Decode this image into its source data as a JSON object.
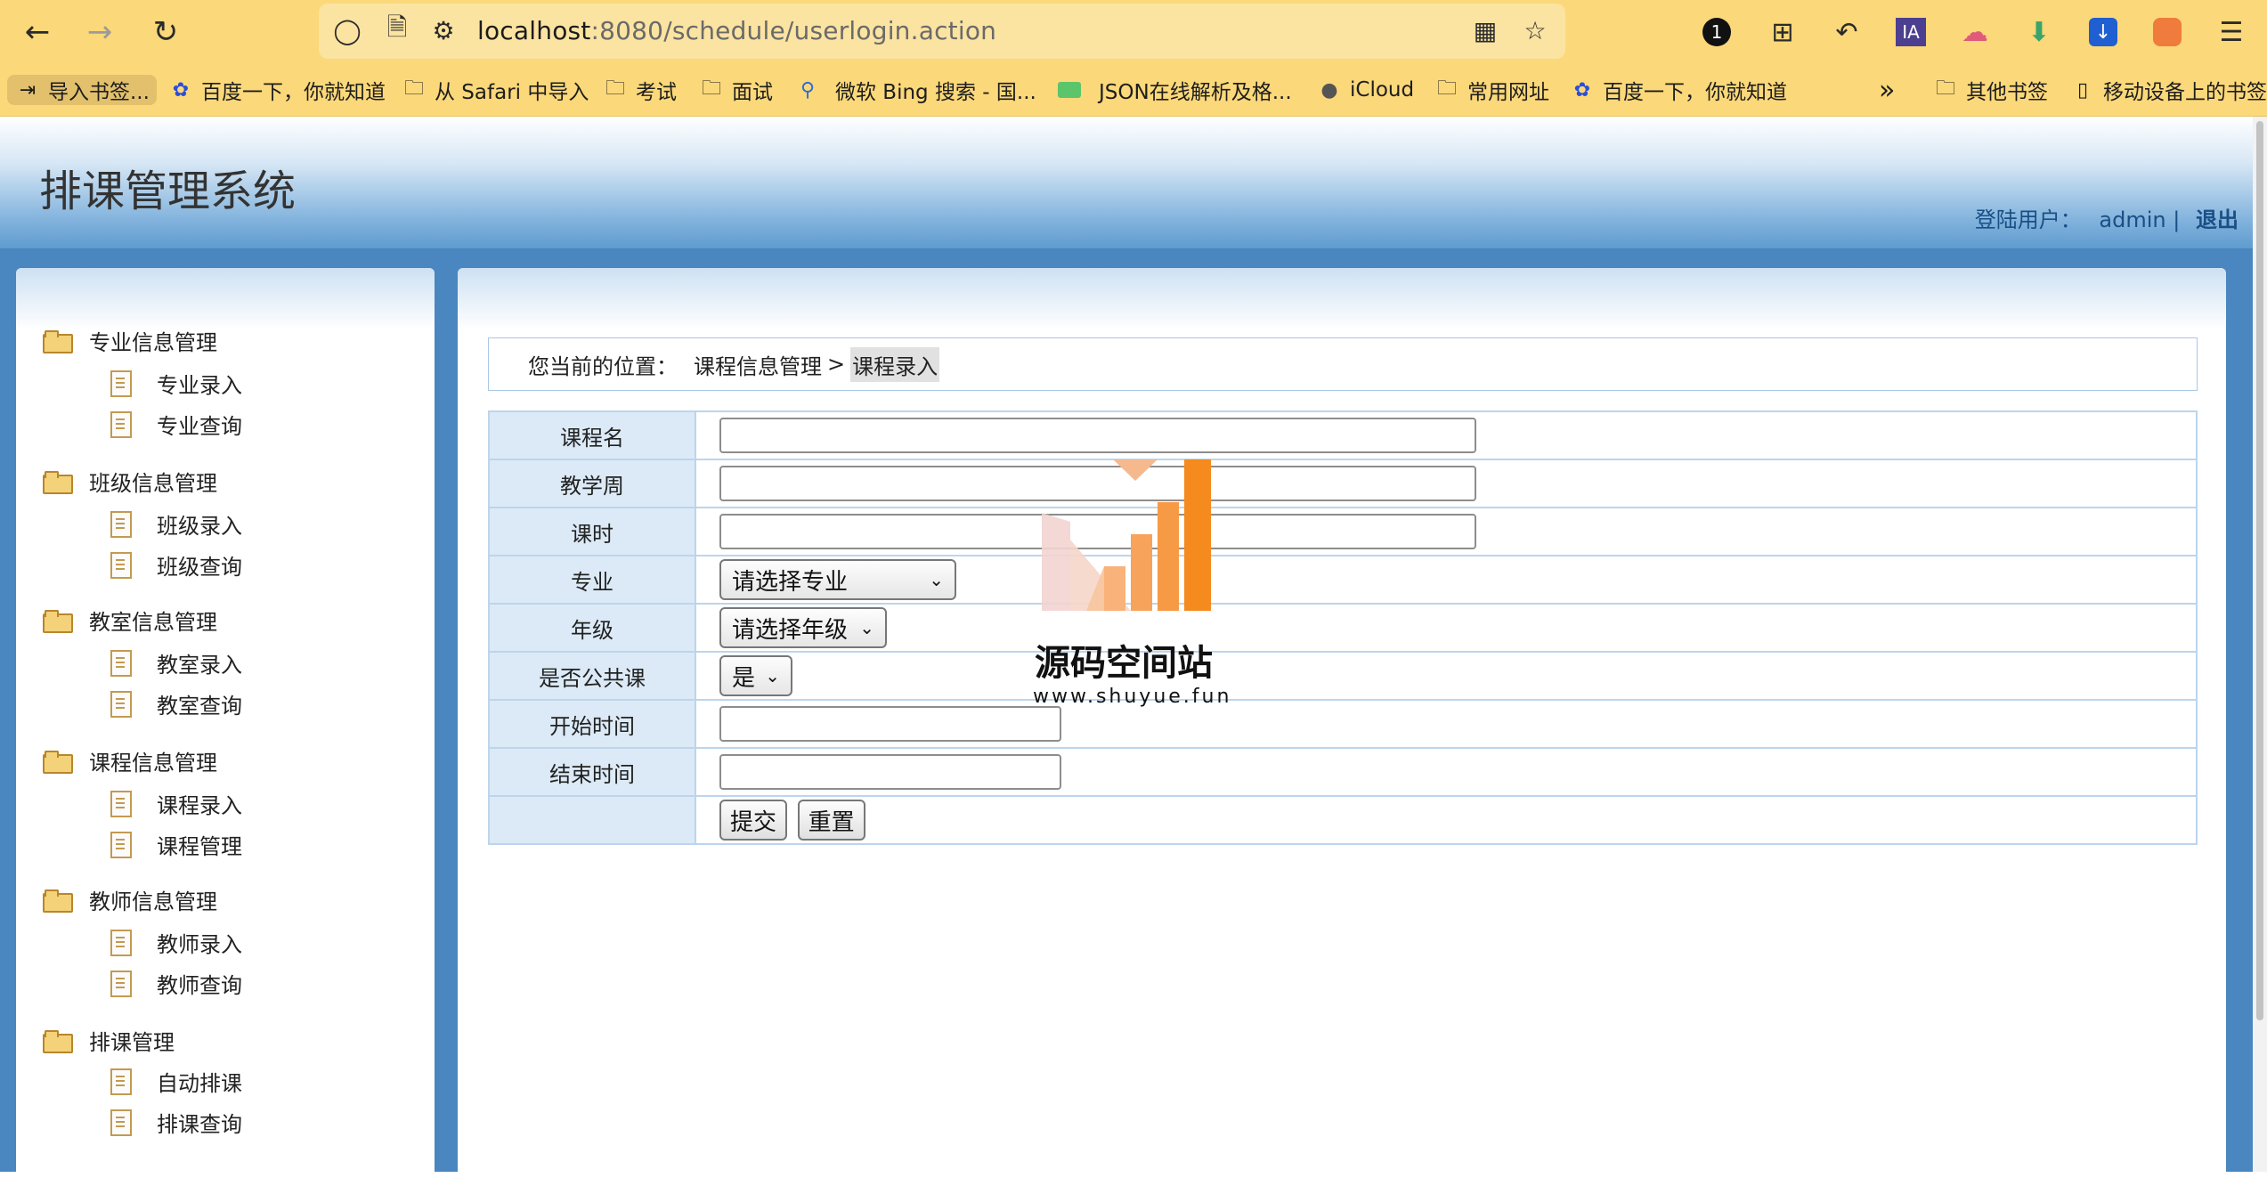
{
  "browser": {
    "url_host": "localhost",
    "url_rest": ":8080/schedule/userlogin.action",
    "ext_badge": "1",
    "ext_ia": "IA"
  },
  "bookmarks": [
    {
      "label": "导入书签...",
      "icon": "import-icon"
    },
    {
      "label": "百度一下，你就知道",
      "icon": "baidu-icon"
    },
    {
      "label": "从 Safari 中导入",
      "icon": "folder-icon"
    },
    {
      "label": "考试",
      "icon": "folder-icon"
    },
    {
      "label": "面试",
      "icon": "folder-icon"
    },
    {
      "label": "微软 Bing 搜索 - 国...",
      "icon": "search-icon"
    },
    {
      "label": "JSON在线解析及格...",
      "icon": "json-icon"
    },
    {
      "label": "iCloud",
      "icon": "apple-icon"
    },
    {
      "label": "常用网址",
      "icon": "folder-icon"
    },
    {
      "label": "百度一下，你就知道",
      "icon": "baidu-icon"
    },
    {
      "label": "其他书签",
      "icon": "folder-icon"
    },
    {
      "label": "移动设备上的书签",
      "icon": "mobile-icon"
    }
  ],
  "header": {
    "title": "排课管理系统",
    "user_label": "登陆用户：",
    "username": "admin",
    "separator": "|",
    "logout": "退出"
  },
  "sidebar": {
    "groups": [
      {
        "title": "专业信息管理",
        "items": [
          "专业录入",
          "专业查询"
        ]
      },
      {
        "title": "班级信息管理",
        "items": [
          "班级录入",
          "班级查询"
        ]
      },
      {
        "title": "教室信息管理",
        "items": [
          "教室录入",
          "教室查询"
        ]
      },
      {
        "title": "课程信息管理",
        "items": [
          "课程录入",
          "课程管理"
        ]
      },
      {
        "title": "教师信息管理",
        "items": [
          "教师录入",
          "教师查询"
        ]
      },
      {
        "title": "排课管理",
        "items": [
          "自动排课",
          "排课查询"
        ]
      }
    ]
  },
  "breadcrumb": {
    "label": "您当前的位置：",
    "parent": "课程信息管理",
    "sep": ">",
    "current": "课程录入"
  },
  "form": {
    "course_name": {
      "label": "课程名",
      "value": ""
    },
    "teaching_week": {
      "label": "教学周",
      "value": ""
    },
    "hours": {
      "label": "课时",
      "value": ""
    },
    "major": {
      "label": "专业",
      "selected": "请选择专业"
    },
    "grade": {
      "label": "年级",
      "selected": "请选择年级"
    },
    "is_public": {
      "label": "是否公共课",
      "selected": "是"
    },
    "start_time": {
      "label": "开始时间",
      "value": ""
    },
    "end_time": {
      "label": "结束时间",
      "value": ""
    },
    "submit": "提交",
    "reset": "重置"
  },
  "watermark": {
    "name": "源码空间站",
    "site": "www.shuyue.fun"
  }
}
